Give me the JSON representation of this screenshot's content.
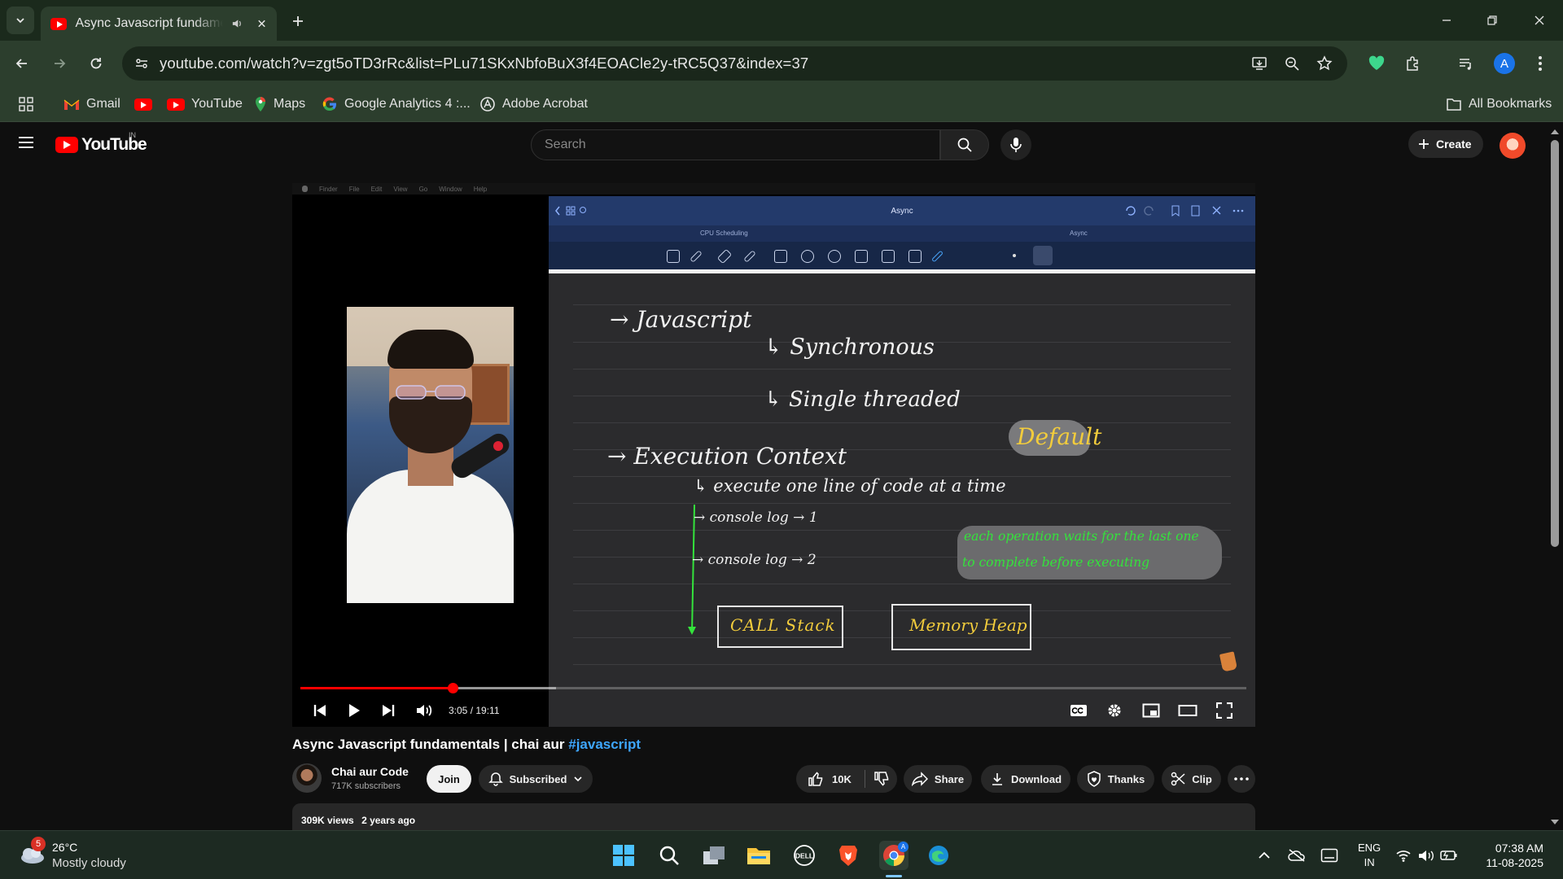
{
  "browser": {
    "tab": {
      "title": "Async Javascript fundamentals | chai aur #javascript"
    },
    "url": "youtube.com/watch?v=zgt5oTD3rRc&list=PLu71SKxNbfoBuX3f4EOACle2y-tRC5Q37&index=37",
    "bookmarks": [
      {
        "label": "Gmail",
        "icon": "gmail-icon"
      },
      {
        "label": "",
        "icon": "youtube-icon"
      },
      {
        "label": "YouTube",
        "icon": "youtube-icon"
      },
      {
        "label": "Maps",
        "icon": "maps-icon"
      },
      {
        "label": "Google Analytics 4 :...",
        "icon": "google-icon"
      },
      {
        "label": "Adobe Acrobat",
        "icon": "acrobat-icon"
      }
    ],
    "all_bookmarks_label": "All Bookmarks",
    "profile_initial": "A"
  },
  "youtube": {
    "logo_text": "YouTube",
    "region": "IN",
    "search_placeholder": "Search",
    "create_label": "Create"
  },
  "player": {
    "current_time": "3:05",
    "duration": "19:11",
    "time_display": "3:05 / 19:11",
    "progress_fraction": 0.161,
    "buffered_fraction": 0.27,
    "mac_menu": [
      "Finder",
      "File",
      "Edit",
      "View",
      "Go",
      "Window",
      "Help"
    ],
    "ipad": {
      "title": "Async",
      "tabs": [
        "CPU Scheduling",
        "Async"
      ],
      "notes": {
        "line1": "→ Javascript",
        "line2": "↳ Synchronous",
        "line3": "↳ Single threaded",
        "default_label": "Default",
        "line4": "→ Execution Context",
        "line5": "↳ execute one line of code at a time",
        "log1": "→ console log → 1",
        "log2": "→ console log → 2",
        "green_note_1": "each operation waits for the last one",
        "green_note_2": "to complete before executing",
        "call_stack": "CALL Stack",
        "memory_heap": "Memory Heap"
      }
    }
  },
  "video": {
    "title_main": "Async Javascript fundamentals | chai aur ",
    "title_hashtag": "#javascript",
    "channel_name": "Chai aur Code",
    "subscribers": "717K subscribers",
    "join_label": "Join",
    "subscribed_label": "Subscribed",
    "likes": "10K",
    "share_label": "Share",
    "download_label": "Download",
    "thanks_label": "Thanks",
    "clip_label": "Clip",
    "views": "309K views",
    "age": "2 years ago"
  },
  "taskbar": {
    "weather_badge": "5",
    "temperature": "26°C",
    "weather": "Mostly cloudy",
    "lang_line1": "ENG",
    "lang_line2": "IN",
    "time": "07:38 AM",
    "date": "11-08-2025"
  },
  "colors": {
    "chrome_frame": "#2c3e2d",
    "yt_red": "#ff0000",
    "hashtag_blue": "#3ea6ff",
    "highlight_yellow": "#f2cc3c",
    "note_green": "#34e33c"
  }
}
